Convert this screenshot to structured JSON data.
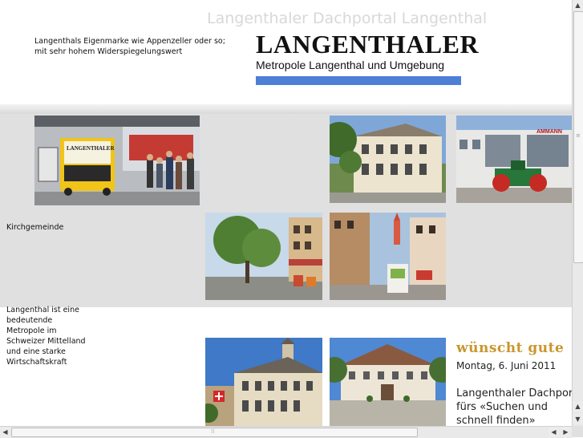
{
  "header": {
    "site_title": "Langenthaler Dachportal Langenthal",
    "tagline": "Langenthals Eigenmarke wie Appenzeller oder so; mit sehr hohem Widerspiegelungswert",
    "logo": {
      "main": "LANGENTHALER",
      "sub": "Metropole Langenthal und Umgebung",
      "bar_color": "#4d7fd6"
    }
  },
  "gallery": {
    "label": "Kirchgemeinde",
    "photos": [
      {
        "name": "bus-station-photo",
        "sign": "LANGENTHALER"
      },
      {
        "name": "villa-building-photo"
      },
      {
        "name": "factory-roller-photo",
        "sign": "AMMANN"
      },
      {
        "name": "tree-street-photo"
      },
      {
        "name": "old-town-street-photo"
      }
    ]
  },
  "intro_text": "Langenthal ist eine bedeutende Metropole im Schweizer Mittelland und eine starke Wirtschaftskraft",
  "lower_photos": [
    {
      "name": "town-hall-photo"
    },
    {
      "name": "castle-building-photo"
    }
  ],
  "news": {
    "greeting": "wünscht gute",
    "date": "Montag, 6. Juni 2011",
    "claim": "Langenthaler Dachportal fürs «Suchen und schnell finden»",
    "greeting_color": "#c9962e"
  }
}
